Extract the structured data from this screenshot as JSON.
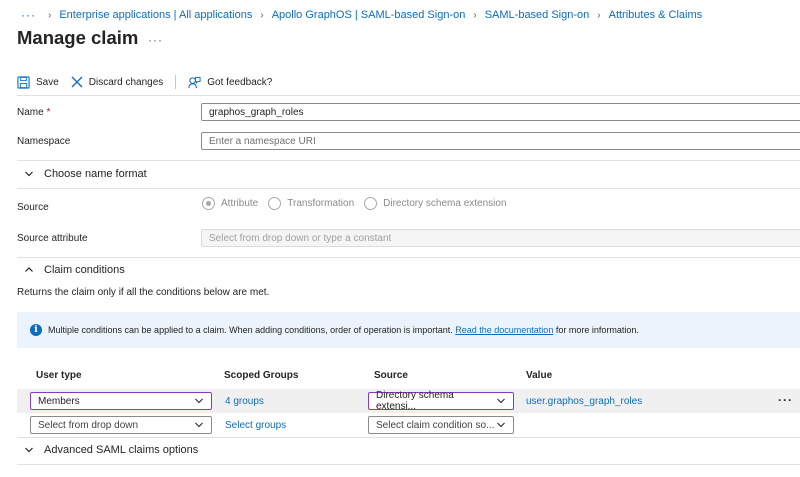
{
  "breadcrumb": {
    "overflow": "···",
    "items": [
      "Enterprise applications | All applications",
      "Apollo GraphOS | SAML-based Sign-on",
      "SAML-based Sign-on",
      "Attributes & Claims"
    ]
  },
  "page": {
    "title": "Manage claim",
    "more": "···"
  },
  "toolbar": {
    "save_label": "Save",
    "discard_label": "Discard changes",
    "feedback_label": "Got feedback?"
  },
  "form": {
    "name_label": "Name",
    "name_required": "*",
    "name_value": "graphos_graph_roles",
    "namespace_label": "Namespace",
    "namespace_placeholder": "Enter a namespace URI",
    "choose_name_format": "Choose name format",
    "source_label": "Source",
    "source_options": [
      "Attribute",
      "Transformation",
      "Directory schema extension"
    ],
    "source_selected": "Attribute",
    "source_attribute_label": "Source attribute",
    "source_attribute_placeholder": "Select from drop down or type a constant"
  },
  "claim_conditions": {
    "header": "Claim conditions",
    "description": "Returns the claim only if all the conditions below are met.",
    "info_text": "Multiple conditions can be applied to a claim.  When adding conditions, order of operation is important.",
    "info_link": "Read the documentation",
    "info_suffix": "for more information.",
    "columns": [
      "User type",
      "Scoped Groups",
      "Source",
      "Value"
    ],
    "rows": [
      {
        "user_type": "Members",
        "scoped_groups": "4 groups",
        "source": "Directory schema extensi...",
        "value": "user.graphos_graph_roles",
        "more": "···"
      },
      {
        "user_type": "Select from drop down",
        "scoped_groups": "Select groups",
        "source": "Select claim condition so...",
        "value": ""
      }
    ]
  },
  "advanced": {
    "header": "Advanced SAML claims options"
  },
  "colors": {
    "accent": "#0f6cbd",
    "required": "#c50f1f",
    "active_border": "#8a3bbd",
    "info_bg": "#ebf3fc"
  }
}
